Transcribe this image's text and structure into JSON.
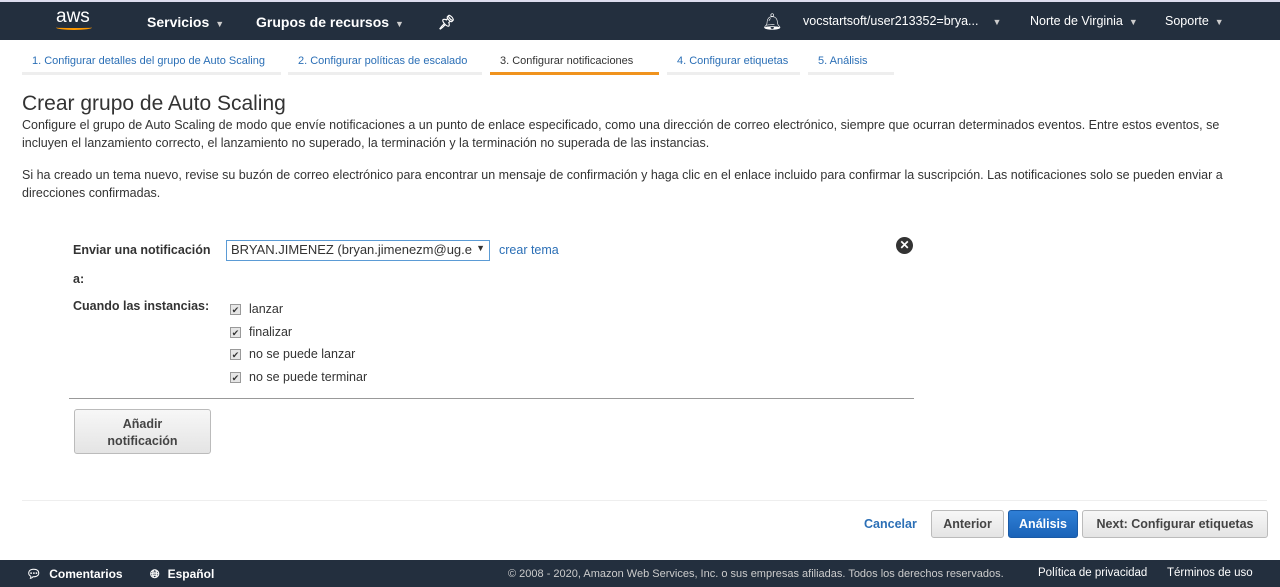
{
  "topbar": {
    "logo": "aws",
    "services": "Servicios",
    "resource_groups": "Grupos de recursos",
    "account": "vocstartsoft/user213352=brya...",
    "region": "Norte de Virginia",
    "support": "Soporte"
  },
  "steps": [
    "1. Configurar detalles del grupo de Auto Scaling",
    "2. Configurar políticas de escalado",
    "3. Configurar notificaciones",
    "4. Configurar etiquetas",
    "5. Análisis"
  ],
  "page": {
    "title": "Crear grupo de Auto Scaling",
    "desc1": "Configure el grupo de Auto Scaling de modo que envíe notificaciones a un punto de enlace especificado, como una dirección de correo electrónico, siempre que ocurran determinados eventos. Entre estos eventos, se incluyen el lanzamiento correcto, el lanzamiento no superado, la terminación y la terminación no superada de las instancias.",
    "desc2": "Si ha creado un tema nuevo, revise su buzón de correo electrónico para encontrar un mensaje de confirmación y haga clic en el enlace incluido para confirmar la suscripción. Las notificaciones solo se pueden enviar a direcciones confirmadas."
  },
  "form": {
    "send_label_1": "Enviar una notificación",
    "send_label_2": "a:",
    "topic_value": "BRYAN.JIMENEZ (bryan.jimenezm@ug.e",
    "create_topic": "crear tema",
    "when_label": "Cuando las instancias:",
    "events": [
      {
        "label": "lanzar",
        "checked": true
      },
      {
        "label": "finalizar",
        "checked": true
      },
      {
        "label": "no se puede lanzar",
        "checked": true
      },
      {
        "label": "no se puede terminar",
        "checked": true
      }
    ],
    "add_line1": "Añadir",
    "add_line2": "notificación"
  },
  "actions": {
    "cancel": "Cancelar",
    "previous": "Anterior",
    "review": "Análisis",
    "next": "Next: Configurar etiquetas"
  },
  "footer": {
    "feedback": "Comentarios",
    "language": "Español",
    "copyright": "© 2008 - 2020, Amazon Web Services, Inc. o sus empresas afiliadas. Todos los derechos reservados.",
    "privacy": "Política de privacidad",
    "terms": "Términos de uso"
  }
}
